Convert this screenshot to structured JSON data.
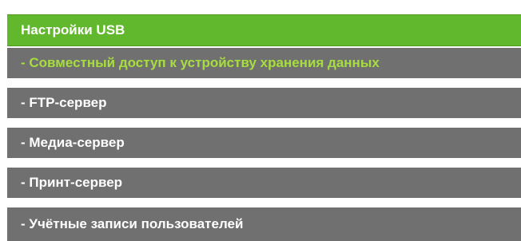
{
  "menu": {
    "header": "Настройки USB",
    "items": [
      {
        "label": "- Совместный доступ к устройству хранения данных",
        "active": true
      },
      {
        "label": "- FTP-сервер",
        "active": false
      },
      {
        "label": "- Медиа-сервер",
        "active": false
      },
      {
        "label": "- Принт-сервер",
        "active": false
      },
      {
        "label": "- Учётные записи пользователей",
        "active": false
      }
    ]
  },
  "colors": {
    "header_bg": "#62b82c",
    "item_bg": "#707070",
    "active_text": "#a7de3f",
    "text": "#ffffff"
  }
}
